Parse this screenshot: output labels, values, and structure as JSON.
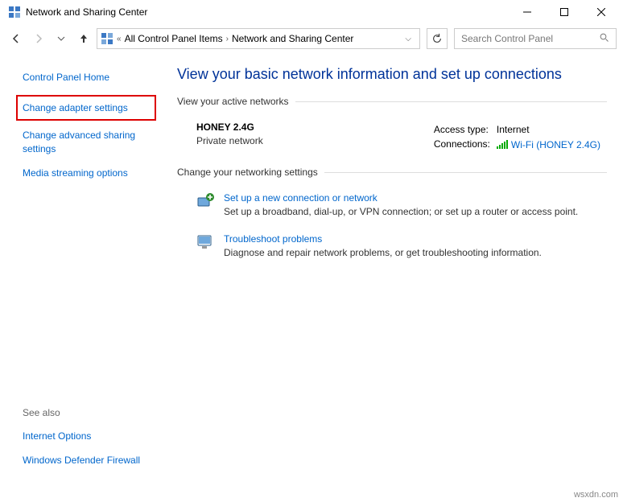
{
  "window": {
    "title": "Network and Sharing Center"
  },
  "breadcrumb": {
    "sep": "«",
    "items": [
      "All Control Panel Items",
      "Network and Sharing Center"
    ]
  },
  "search": {
    "placeholder": "Search Control Panel"
  },
  "sidebar": {
    "home": "Control Panel Home",
    "items": [
      "Change adapter settings",
      "Change advanced sharing settings",
      "Media streaming options"
    ],
    "seealso_header": "See also",
    "seealso": [
      "Internet Options",
      "Windows Defender Firewall"
    ]
  },
  "main": {
    "heading": "View your basic network information and set up connections",
    "active_header": "View your active networks",
    "network": {
      "name": "HONEY 2.4G",
      "type": "Private network",
      "access_label": "Access type:",
      "access_value": "Internet",
      "conn_label": "Connections:",
      "conn_value": "Wi-Fi (HONEY 2.4G)"
    },
    "change_header": "Change your networking settings",
    "settings": [
      {
        "title": "Set up a new connection or network",
        "desc": "Set up a broadband, dial-up, or VPN connection; or set up a router or access point."
      },
      {
        "title": "Troubleshoot problems",
        "desc": "Diagnose and repair network problems, or get troubleshooting information."
      }
    ]
  },
  "watermark": "wsxdn.com"
}
